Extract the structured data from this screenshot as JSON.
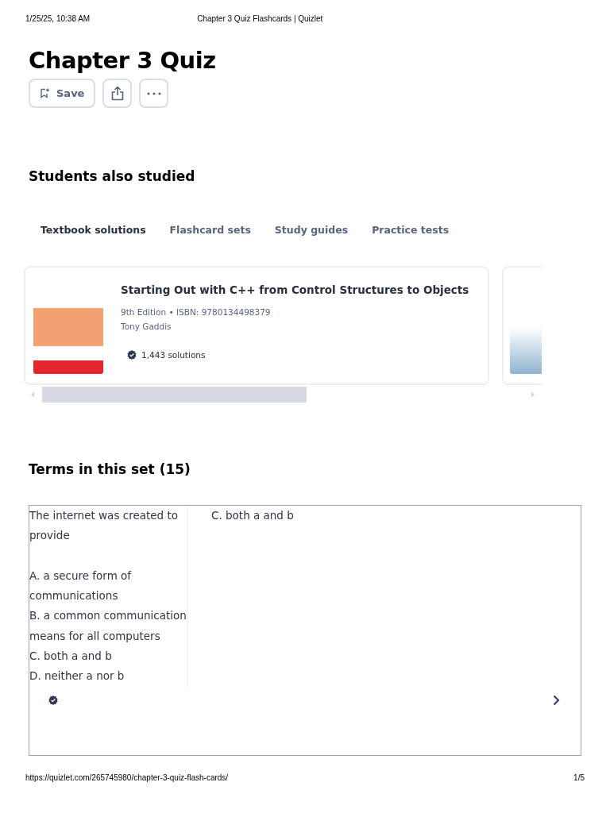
{
  "print_header": {
    "date": "1/25/25, 10:38 AM",
    "title": "Chapter 3 Quiz Flashcards | Quizlet"
  },
  "title": "Chapter 3 Quiz",
  "actions": {
    "save_label": "Save"
  },
  "related": {
    "heading": "Students also studied",
    "tabs": [
      {
        "label": "Textbook solutions",
        "selected": true
      },
      {
        "label": "Flashcard sets",
        "selected": false
      },
      {
        "label": "Study guides",
        "selected": false
      },
      {
        "label": "Practice tests",
        "selected": false
      }
    ],
    "books": [
      {
        "title": "Starting Out with C++ from Control Structures to Objects",
        "edition": "9th Edition • ISBN: 9780134498379",
        "author": "Tony Gaddis",
        "solutions": "1,443 solutions"
      }
    ]
  },
  "terms": {
    "heading": "Terms in this set (15)",
    "items": [
      {
        "term": "The internet was created to provide\n\nA. a secure form of communications\nB. a common communication means for all computers\nC. both a and b\nD. neither a nor b",
        "definition": "C. both a and b"
      }
    ]
  },
  "print_footer": {
    "url": "https://quizlet.com/265745980/chapter-3-quiz-flash-cards/",
    "page": "1/5"
  }
}
